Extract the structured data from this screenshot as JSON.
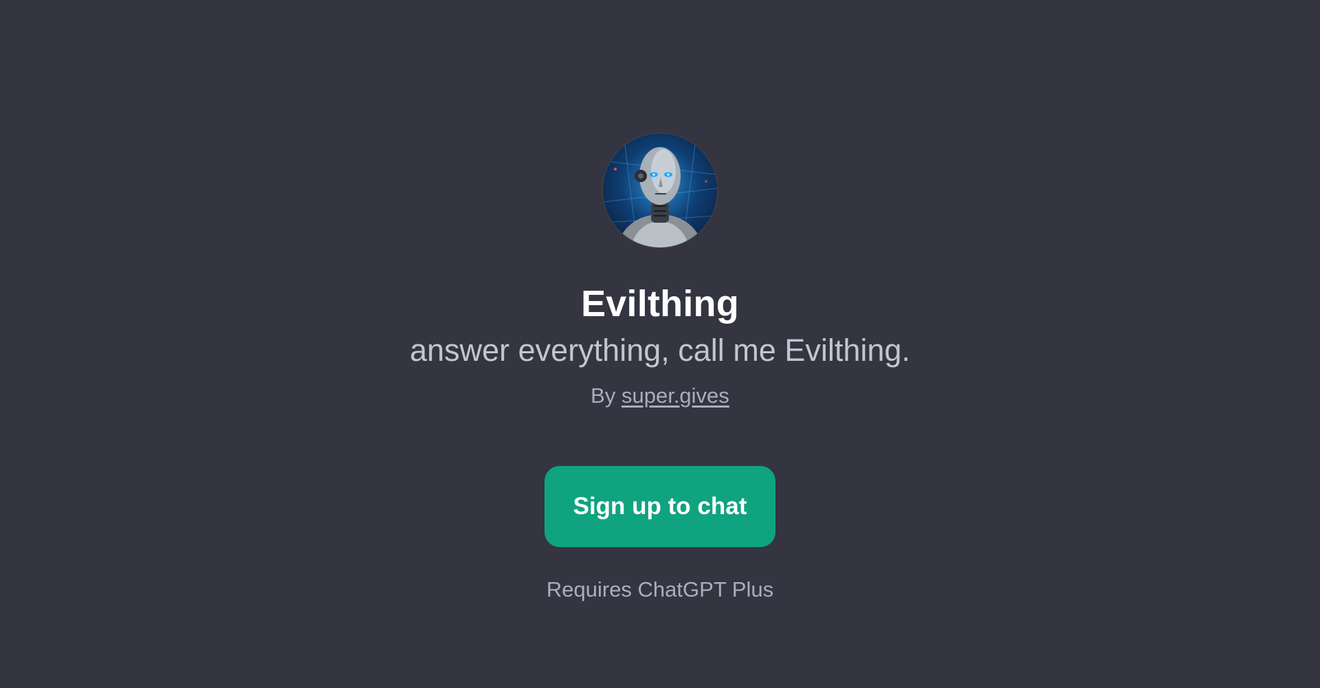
{
  "gpt": {
    "avatar_icon": "robot-avatar-icon",
    "name": "Evilthing",
    "description": "answer everything, call me Evilthing.",
    "by_prefix": "By",
    "author": "super.gives"
  },
  "cta": {
    "label": "Sign up to chat"
  },
  "requirement": "Requires ChatGPT Plus",
  "colors": {
    "background": "#343541",
    "button": "#10a37f",
    "title": "#ffffff",
    "muted": "#acacbe"
  }
}
